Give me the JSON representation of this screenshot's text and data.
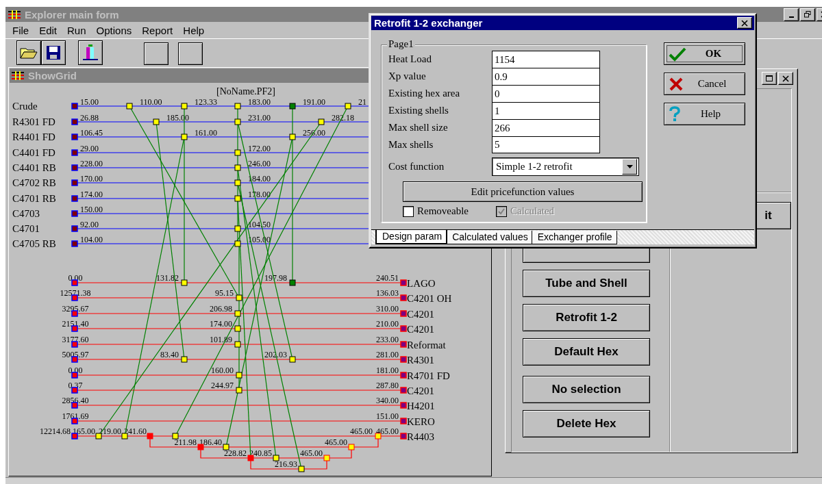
{
  "main_window": {
    "title": "Explorer main form"
  },
  "menu": [
    "File",
    "Edit",
    "Run",
    "Options",
    "Report",
    "Help"
  ],
  "grid_window": {
    "title": "ShowGrid",
    "file_label": "[NoName.PF2]",
    "hot_streams": [
      {
        "name": "Crude",
        "temp": "15.00",
        "labels": [
          "110.00",
          "123.33",
          "183.00",
          "191.00",
          "21"
        ]
      },
      {
        "name": "R4301 FD",
        "temp": "26.88",
        "labels": [
          "185.00",
          "231.00",
          "282.18"
        ]
      },
      {
        "name": "R4401 FD",
        "temp": "106.45",
        "labels": [
          "161.00",
          "256.00"
        ]
      },
      {
        "name": "C4401 FD",
        "temp": "29.00",
        "labels": [
          "172.00"
        ]
      },
      {
        "name": "C4401 RB",
        "temp": "228.00",
        "labels": [
          "246.00"
        ]
      },
      {
        "name": "C4702 RB",
        "temp": "170.00",
        "labels": [
          "184.00"
        ]
      },
      {
        "name": "C4701 RB",
        "temp": "174.00",
        "labels": [
          "178.00"
        ]
      },
      {
        "name": "C4703",
        "temp": "150.00"
      },
      {
        "name": "C4701",
        "temp": "92.00",
        "labels": [
          "104.50"
        ]
      },
      {
        "name": "C4705 RB",
        "temp": "104.00",
        "labels": [
          "105.00"
        ]
      }
    ],
    "cold_streams": [
      {
        "name": "LAGO",
        "start": "0.00",
        "end": "240.51",
        "labels": [
          "131.82",
          "197.98"
        ]
      },
      {
        "name": "C4201 OH",
        "start": "12571.38",
        "end": "136.03",
        "labels": [
          "95.15"
        ]
      },
      {
        "name": "C4201",
        "start": "3295.67",
        "end": "310.00",
        "labels": [
          "206.98"
        ]
      },
      {
        "name": "C4201",
        "start": "2151.40",
        "end": "210.00",
        "labels": [
          "174.00"
        ]
      },
      {
        "name": "Reformat",
        "start": "3177.60",
        "end": "233.00",
        "labels": [
          "101.89"
        ]
      },
      {
        "name": "R4301",
        "start": "5005.97",
        "end": "281.00",
        "labels": [
          "83.40",
          "202.03"
        ]
      },
      {
        "name": "R4701 FD",
        "start": "0.00",
        "end": "181.00",
        "labels": [
          "160.00"
        ]
      },
      {
        "name": "C4201",
        "start": "0.37",
        "end": "287.80",
        "labels": [
          "244.97"
        ]
      },
      {
        "name": "H4201",
        "start": "2856.40",
        "end": "340.00"
      },
      {
        "name": "KERO",
        "start": "1761.69",
        "end": "151.00"
      },
      {
        "name": "R4403",
        "start": "12214.68",
        "end": "465.00",
        "labels": [
          "165.00",
          "219.00",
          "241.60",
          "465.00"
        ]
      }
    ],
    "branches": [
      {
        "labels": [
          "211.98",
          "186.40",
          "465.00"
        ]
      },
      {
        "labels": [
          "228.82",
          "240.85",
          "465.00"
        ]
      },
      {
        "labels": [
          "216.93"
        ]
      }
    ]
  },
  "side_window": {
    "partial_button": "it",
    "buttons": [
      "Tube and Shell",
      "Retrofit 1-2",
      "Default Hex",
      "No selection",
      "Delete Hex"
    ]
  },
  "dialog": {
    "title": "Retrofit 1-2 exchanger",
    "group_label": "Page1",
    "fields": [
      {
        "label": "Heat Load",
        "value": "1154"
      },
      {
        "label": "Xp value",
        "value": "0.9"
      },
      {
        "label": "Existing hex area",
        "value": "0"
      },
      {
        "label": "Existing shells",
        "value": "1"
      },
      {
        "label": "Max shell size",
        "value": "266"
      },
      {
        "label": "Max shells",
        "value": "5"
      }
    ],
    "cost_function": {
      "label": "Cost function",
      "value": "Simple 1-2 retrofit"
    },
    "edit_button": "Edit pricefunction values",
    "checkboxes": [
      {
        "label": "Removeable",
        "checked": false,
        "disabled": false
      },
      {
        "label": "Calculated",
        "checked": true,
        "disabled": true
      }
    ],
    "buttons": [
      {
        "kind": "ok",
        "label": "OK"
      },
      {
        "kind": "cancel",
        "label": "Cancel"
      },
      {
        "kind": "help",
        "label": "Help"
      }
    ],
    "tabs": [
      {
        "label": "Design param",
        "selected": true
      },
      {
        "label": "Calculated values",
        "selected": false
      },
      {
        "label": "Exchanger profile",
        "selected": false
      }
    ]
  }
}
